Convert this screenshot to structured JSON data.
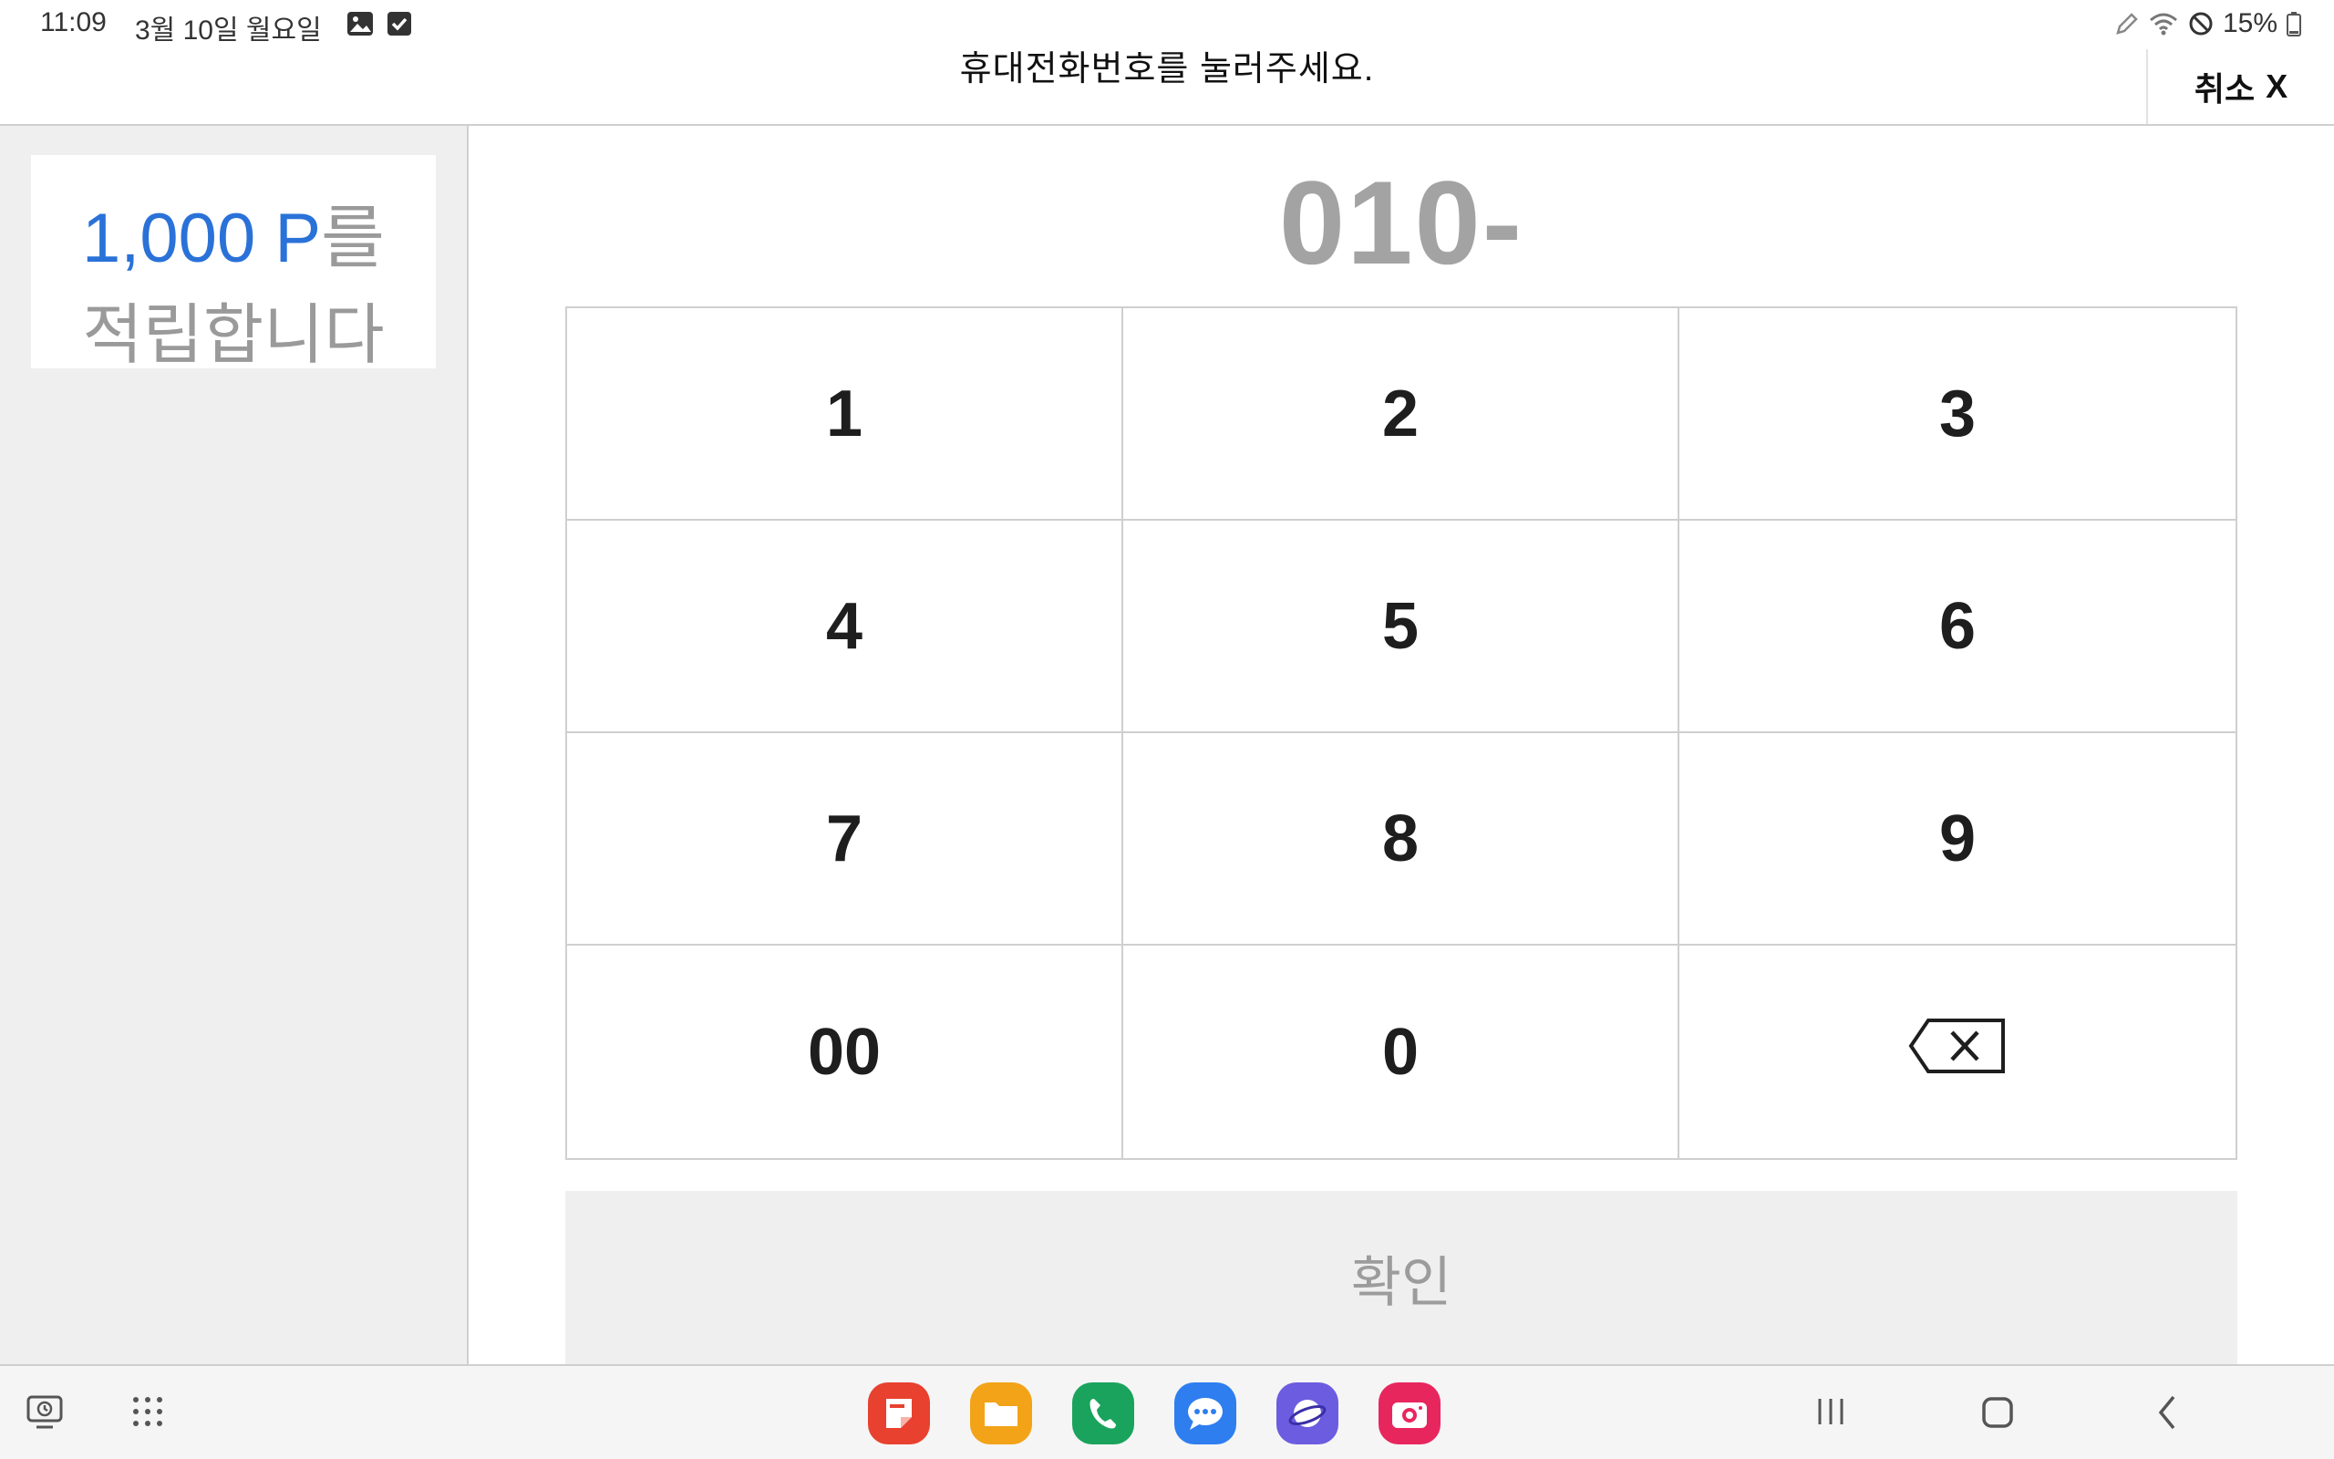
{
  "status_bar": {
    "time": "11:09",
    "date": "3월 10일 월요일",
    "battery": "15%",
    "icons": [
      "gallery-icon",
      "check-icon",
      "pen-icon",
      "wifi-icon",
      "do-not-disturb-icon",
      "battery-icon"
    ]
  },
  "header": {
    "title": "휴대전화번호를 눌러주세요.",
    "cancel_label": "취소",
    "cancel_icon": "X"
  },
  "points": {
    "amount": "1,000 P",
    "suffix": "를",
    "message": "적립합니다",
    "accent_color": "#2a72d8"
  },
  "phone": {
    "value": "010-"
  },
  "keypad": {
    "keys": [
      "1",
      "2",
      "3",
      "4",
      "5",
      "6",
      "7",
      "8",
      "9",
      "00",
      "0"
    ],
    "backspace_icon": "backspace-icon"
  },
  "confirm": {
    "label": "확인"
  },
  "nav_bar": {
    "left_icons": [
      "recent-screen-icon",
      "app-drawer-icon"
    ],
    "apps": [
      {
        "name": "notes-app-icon",
        "color": "#e8412f"
      },
      {
        "name": "files-app-icon",
        "color": "#f2a317"
      },
      {
        "name": "phone-app-icon",
        "color": "#1aa35c"
      },
      {
        "name": "messages-app-icon",
        "color": "#2e7ef0"
      },
      {
        "name": "internet-app-icon",
        "color": "#6b5ce0"
      },
      {
        "name": "camera-app-icon",
        "color": "#e8265e"
      }
    ],
    "system_buttons": [
      "recents-button",
      "home-button",
      "back-button"
    ]
  }
}
